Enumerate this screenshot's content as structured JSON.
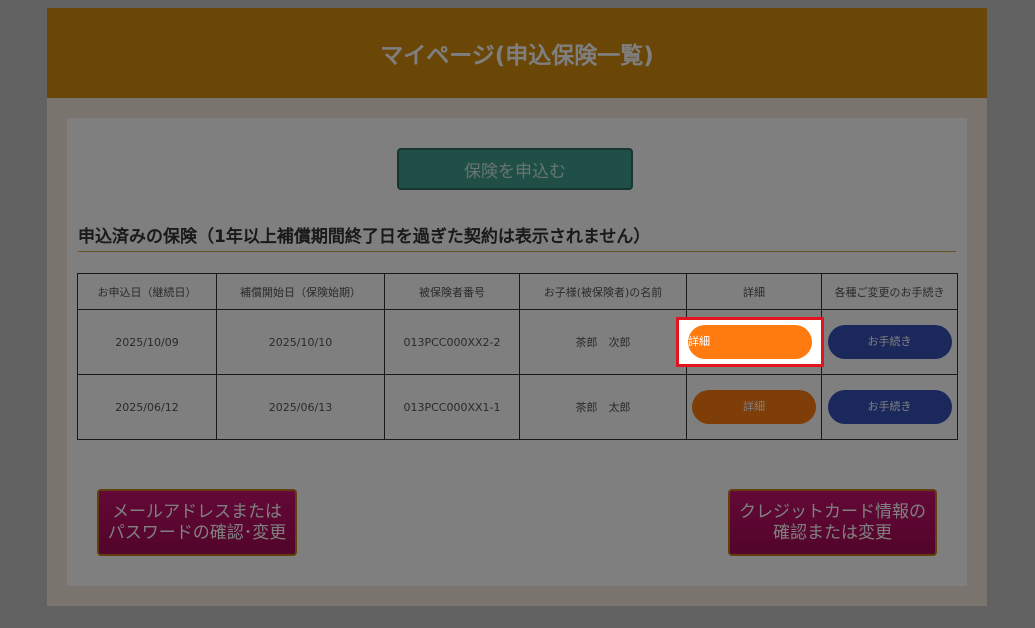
{
  "header": {
    "title": "マイページ(申込保険一覧)"
  },
  "apply_button": {
    "label": "保険を申込む"
  },
  "section": {
    "title": "申込済みの保険（1年以上補償期間終了日を過ぎた契約は表示されません）"
  },
  "table": {
    "headers": [
      "お申込日（継続日）",
      "補償開始日（保険始期）",
      "被保険者番号",
      "お子様(被保険者)の名前",
      "詳細",
      "各種ご変更のお手続き"
    ],
    "rows": [
      {
        "apply_date": "2025/10/09",
        "start_date": "2025/10/10",
        "insured_no": "013PCC000XX2-2",
        "name": "茶郎　次郎",
        "detail": "詳細",
        "procedure": "お手続き"
      },
      {
        "apply_date": "2025/06/12",
        "start_date": "2025/06/13",
        "insured_no": "013PCC000XX1-1",
        "name": "茶郎　太郎",
        "detail": "詳細",
        "procedure": "お手続き"
      }
    ]
  },
  "bottom": {
    "account": {
      "line1": "メールアドレスまたは",
      "line2": "パスワードの確認･変更"
    },
    "card": {
      "line1": "クレジットカード情報の",
      "line2": "確認または変更"
    }
  },
  "colors": {
    "header": "#d58d0e",
    "detail_button": "#ff7b10",
    "procedure_button": "#3450b8",
    "highlight_border": "#e4141e",
    "bottom_button": "#b80d62"
  }
}
